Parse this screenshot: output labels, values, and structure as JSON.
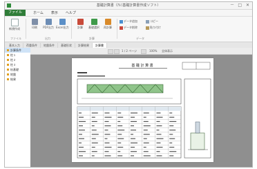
{
  "window": {
    "title": "基礎計算書（ｱﾙﾐ基礎計算書作成ソフト）",
    "minimize": "－",
    "maximize": "□",
    "close": "✕"
  },
  "menu": {
    "file": "ファイル",
    "items": [
      "ホーム",
      "表示",
      "ヘルプ"
    ]
  },
  "ribbon": {
    "buttons": [
      {
        "label": "新規作成",
        "icon": "new-document-icon"
      },
      {
        "label": "印刷",
        "icon": "printer-icon"
      },
      {
        "label": "PDF出力",
        "icon": "pdf-icon"
      },
      {
        "label": "Excel出力",
        "icon": "excel-icon"
      },
      {
        "label": "計算",
        "icon": "calculate-icon"
      },
      {
        "label": "基礎選択",
        "icon": "foundation-icon"
      },
      {
        "label": "再計算",
        "icon": "recalculate-icon"
      }
    ],
    "small_buttons": [
      "データ追加",
      "データ削除",
      "コピー",
      "貼り付け"
    ],
    "groups": [
      "ファイル",
      "出力",
      "計算",
      "データ"
    ]
  },
  "tabs": [
    "基本入力",
    "荷重条件",
    "地盤条件",
    "基礎形状",
    "計算結果",
    "計算書"
  ],
  "active_tab": 5,
  "sidebar": {
    "items": [
      "計算条件",
      "柱１",
      "柱２",
      "柱３",
      "杭基礎",
      "地盤",
      "結果"
    ],
    "selected": 0
  },
  "preview_toolbar": {
    "page_label": "1 / 2 ページ",
    "zoom": "100%",
    "fit_label": "全体表示"
  },
  "document": {
    "heading": "基 礎 計 算 書",
    "rows": 11,
    "cols": 8
  },
  "colors": {
    "accent": "#2f7d38",
    "diagram_fill": "#8fc48a",
    "preview_bg": "#8f8f8f"
  }
}
